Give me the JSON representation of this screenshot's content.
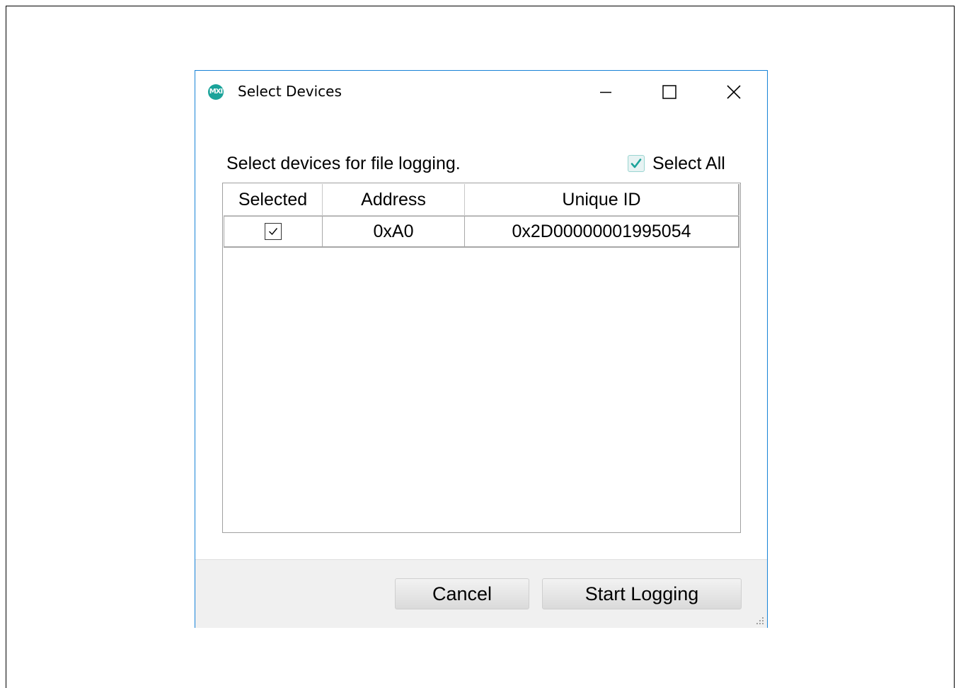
{
  "window": {
    "title": "Select Devices",
    "logo_text": "MXI",
    "accent_color": "#1aa39a",
    "border_color": "#1883d7"
  },
  "titlebar_controls": {
    "minimize_icon": "minimize-icon",
    "maximize_icon": "maximize-icon",
    "close_icon": "close-icon"
  },
  "content": {
    "prompt": "Select devices for file logging.",
    "select_all": {
      "label": "Select All",
      "checked": true
    }
  },
  "grid": {
    "headers": [
      "Selected",
      "Address",
      "Unique ID"
    ],
    "rows": [
      {
        "selected": true,
        "address": "0xA0",
        "unique_id": "0x2D00000001995054"
      }
    ]
  },
  "footer": {
    "cancel_label": "Cancel",
    "start_label": "Start Logging"
  }
}
